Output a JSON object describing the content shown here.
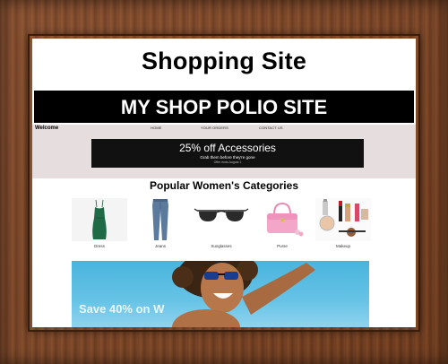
{
  "page": {
    "title": "Shopping Site"
  },
  "site": {
    "banner_title": "MY SHOP POLIO SITE",
    "welcome": "Welcome",
    "nav": [
      "HOME",
      "YOUR ORDERS",
      "CONTACT US"
    ]
  },
  "promo": {
    "title": "25% off Accessories",
    "subtitle": "Grab them before they're gone",
    "note": "Offer ends August 1"
  },
  "categories": {
    "heading": "Popular Women's Categories",
    "items": [
      {
        "label": "Dress",
        "icon": "green-dress-icon"
      },
      {
        "label": "Jeans",
        "icon": "jeans-icon"
      },
      {
        "label": "Sunglasses",
        "icon": "sunglasses-icon"
      },
      {
        "label": "Purse",
        "icon": "pink-purse-icon"
      },
      {
        "label": "Makeup",
        "icon": "makeup-icon"
      }
    ]
  },
  "hero": {
    "text": "Save 40% on W"
  },
  "colors": {
    "frame": "#7a4322",
    "banner_bg": "#000000",
    "nav_bg": "#e6dede",
    "promo_bg": "#111111",
    "hero_bg": "#5bbde3"
  }
}
